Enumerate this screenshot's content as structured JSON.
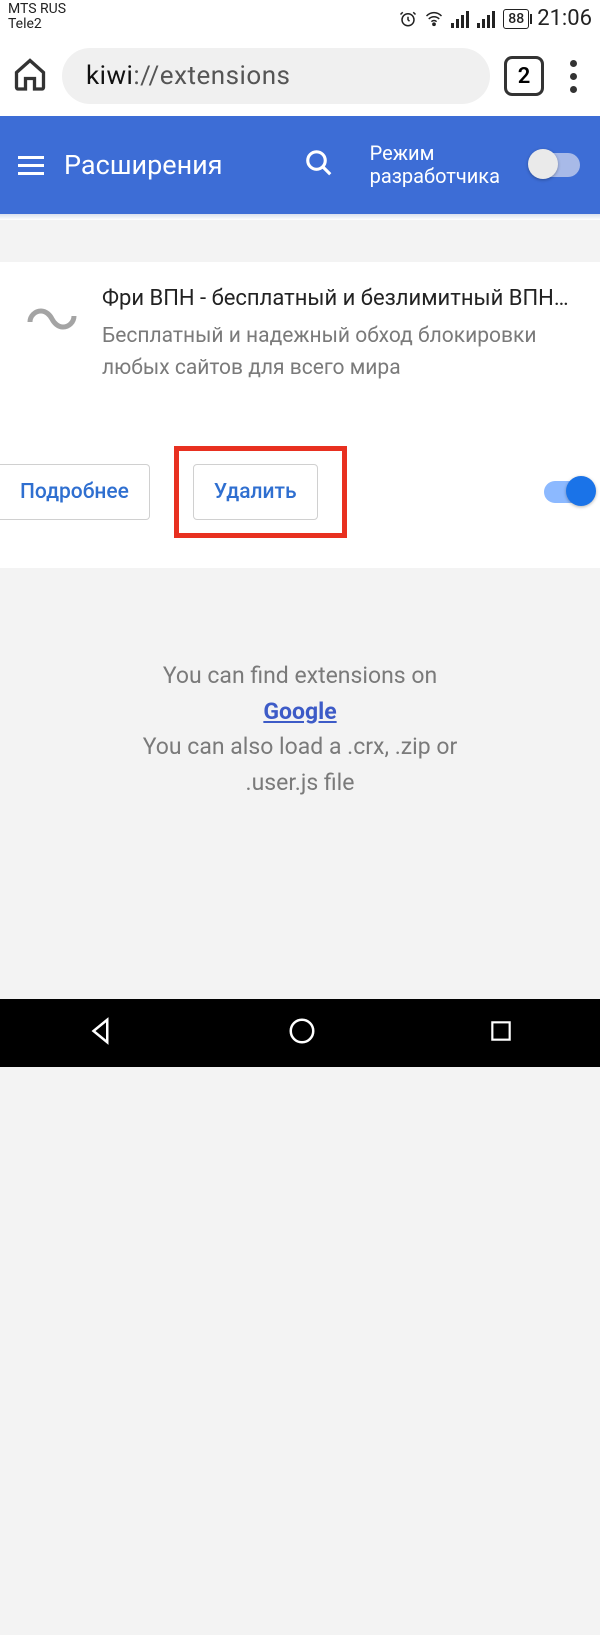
{
  "status": {
    "carrier_line1": "MTS RUS",
    "carrier_line2": "Tele2",
    "battery": "88",
    "time": "21:06"
  },
  "browser": {
    "url_prefix": "kiwi",
    "url_rest": "://extensions",
    "tab_count": "2"
  },
  "header": {
    "title": "Расширения",
    "dev_mode_line1": "Режим",
    "dev_mode_line2": "разработчика"
  },
  "extension": {
    "title": "Фри ВПН - бесплатный и безлимитный ВПН …",
    "description": "Бесплатный и надежный обход блокировки любых сайтов для всего мира",
    "details_label": "Подробнее",
    "delete_label": "Удалить"
  },
  "footer": {
    "line1": "You can find extensions on",
    "google": "Google",
    "line2a": "You can also load a .crx, .zip or",
    "line2b": ".user.js file"
  }
}
